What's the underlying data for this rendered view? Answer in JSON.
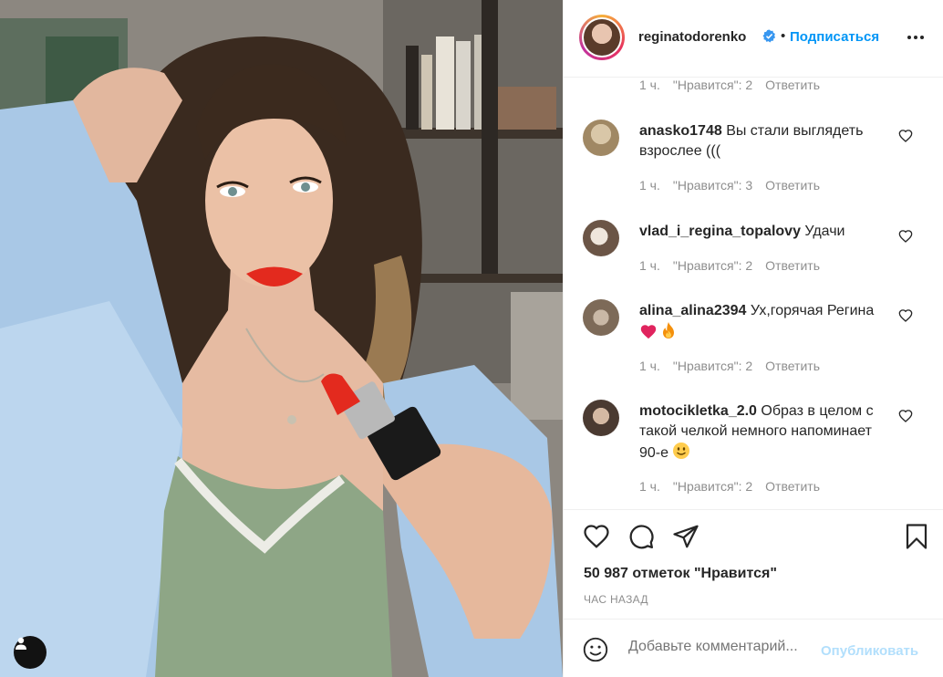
{
  "post": {
    "username": "reginatodorenko",
    "verified": true,
    "follow_label": "Подписаться",
    "more_icon": "more-horizontal-icon"
  },
  "comments": {
    "top_meta": {
      "time": "1 ч.",
      "likes": "\"Нравится\": 2",
      "reply": "Ответить"
    },
    "items": [
      {
        "username": "anasko1748",
        "text": "Вы стали выглядеть взрослее (((",
        "time": "1 ч.",
        "likes": "\"Нравится\": 3",
        "reply": "Ответить"
      },
      {
        "username": "vlad_i_regina_topalovy",
        "text": "Удачи",
        "time": "1 ч.",
        "likes": "\"Нравится\": 2",
        "reply": "Ответить"
      },
      {
        "username": "alina_alina2394",
        "text": "Ух,горячая Регина",
        "time": "1 ч.",
        "likes": "\"Нравится\": 2",
        "reply": "Ответить"
      },
      {
        "username": "motocikletka_2.0",
        "text": "Образ в целом с такой челкой немного напоминает 90-е",
        "time": "1 ч.",
        "likes": "\"Нравится\": 2",
        "reply": "Ответить"
      }
    ]
  },
  "actions": {
    "likes_count": "50 987 отметок \"Нравится\"",
    "timestamp": "ЧАС НАЗАД"
  },
  "add_comment": {
    "placeholder": "Добавьте комментарий...",
    "publish_label": "Опубликовать"
  },
  "colors": {
    "accent": "#0095f6",
    "publish_disabled": "#b2dffc",
    "muted": "#8e8e8e",
    "text": "#262626",
    "heart_emoji": "#e0245e"
  }
}
